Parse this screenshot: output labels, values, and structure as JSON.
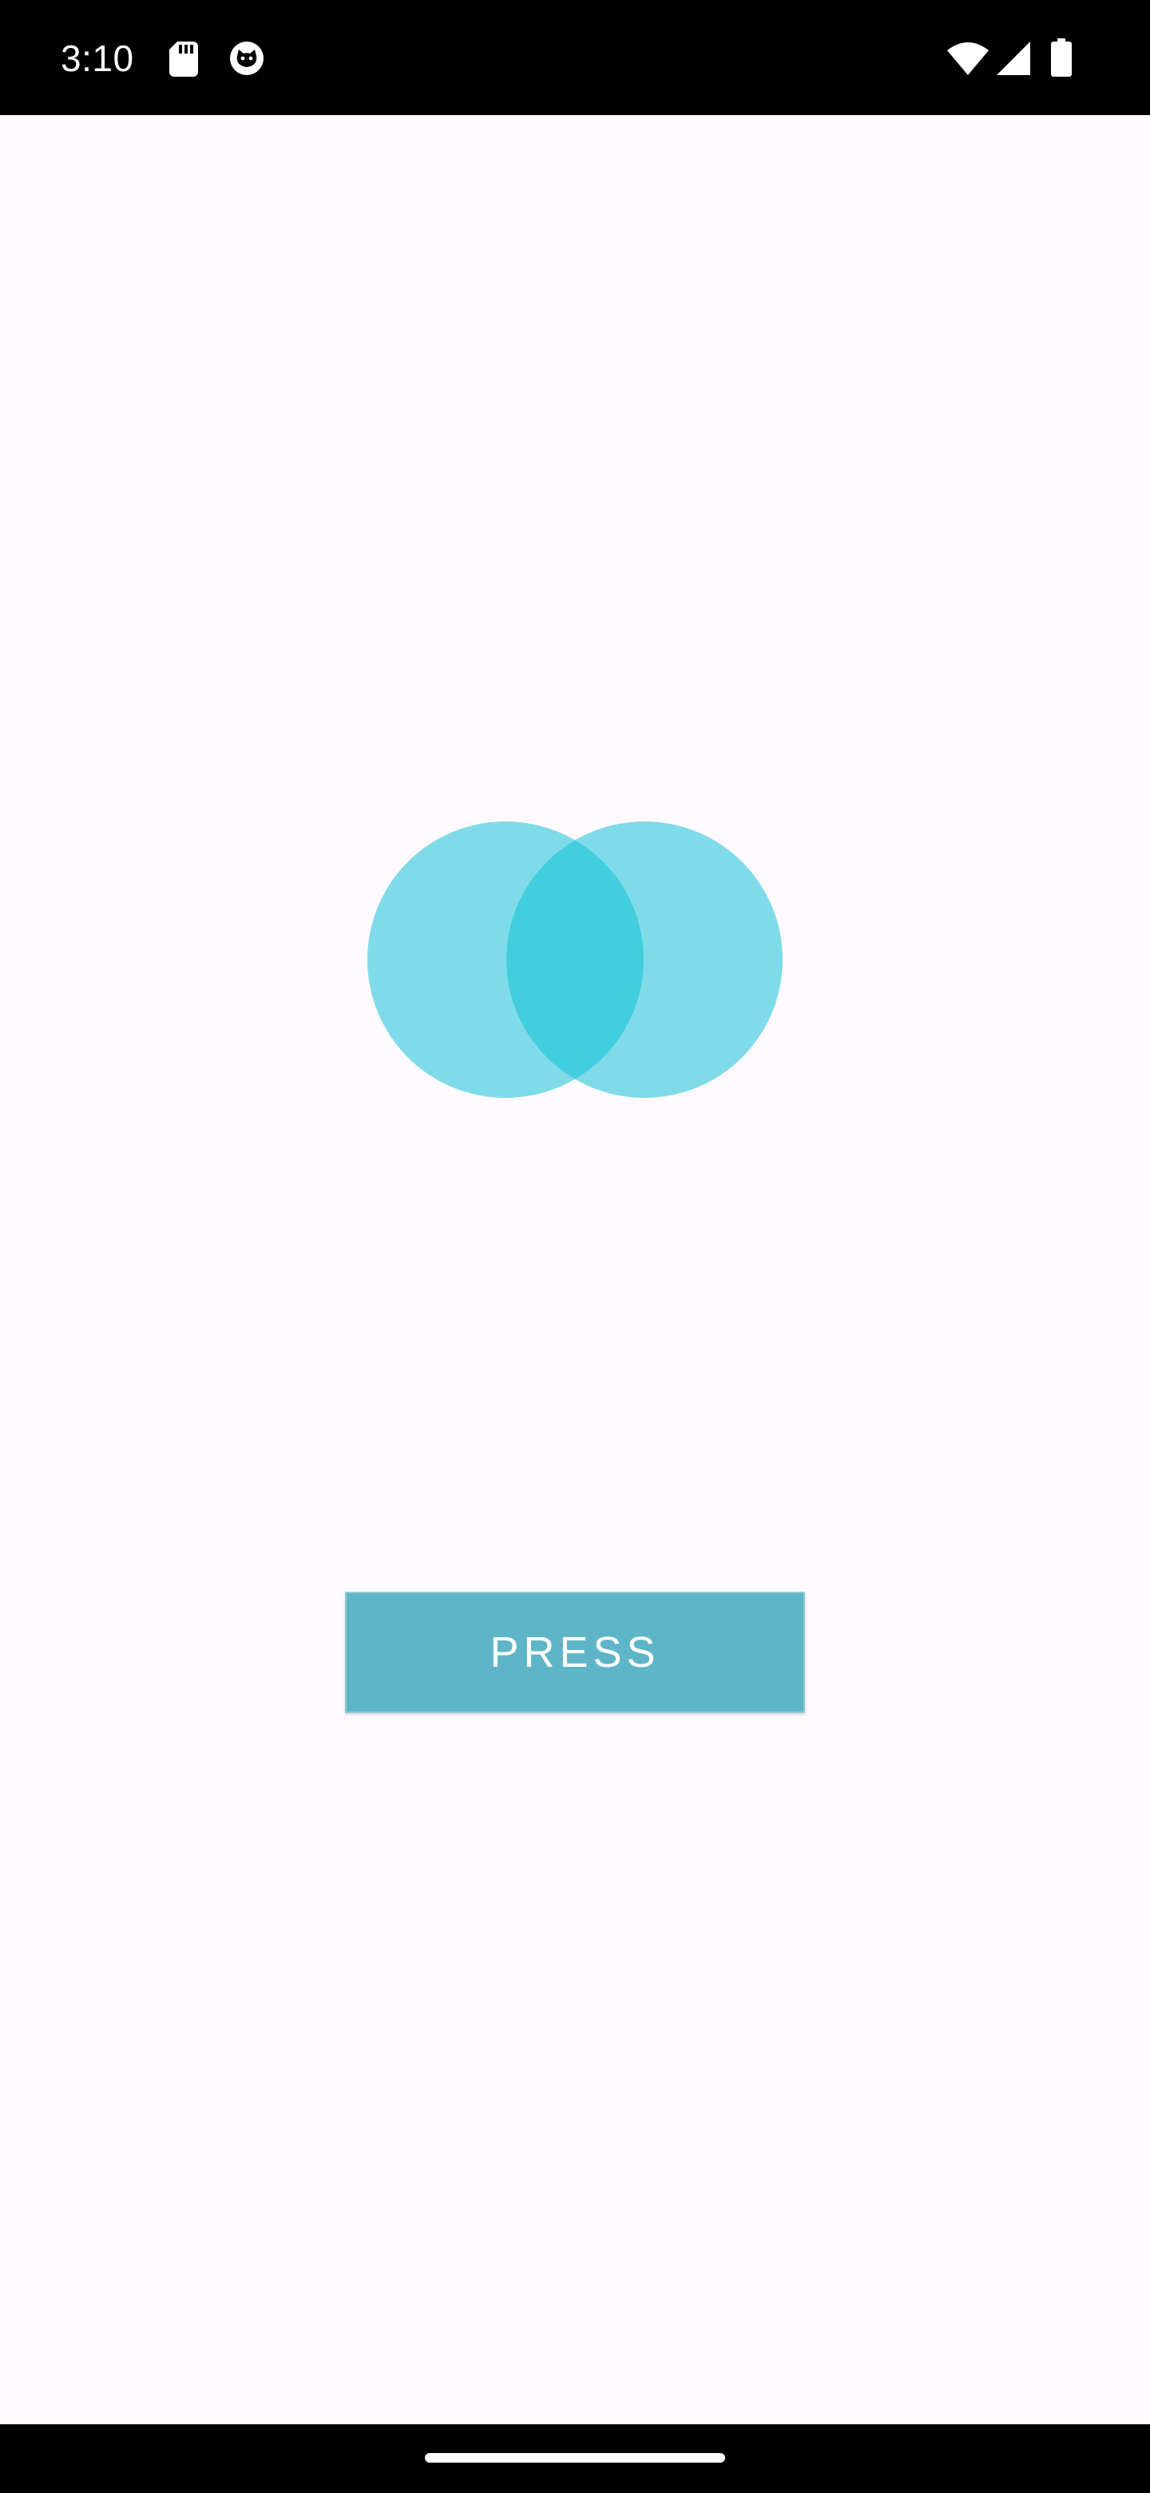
{
  "status_bar": {
    "time": "3:10",
    "left_icons": [
      "sd-card-icon",
      "cat-face-icon"
    ],
    "right_icons": [
      "wifi-icon",
      "cell-signal-icon",
      "battery-icon"
    ],
    "background": "#000000",
    "foreground": "#ffffff"
  },
  "illustration": {
    "type": "overlapping-circles",
    "circle_color": "#80dbe9",
    "overlap_color": "#43cedf"
  },
  "main": {
    "button_label": "PRESS",
    "button_color": "#5fb5c8"
  },
  "navigation_bar": {
    "background": "#000000",
    "handle_color": "#ffffff"
  },
  "page": {
    "background": "#fefafe"
  }
}
